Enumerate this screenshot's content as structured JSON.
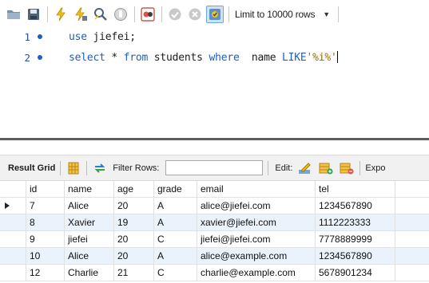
{
  "toolbar": {
    "buttons": [
      {
        "icon": "open-folder-icon"
      },
      {
        "icon": "save-icon"
      },
      {
        "icon": "execute-lightning-icon"
      },
      {
        "icon": "execute-current-lightning-icon"
      },
      {
        "icon": "explain-magnifier-icon"
      },
      {
        "icon": "stop-icon"
      },
      {
        "icon": "toggle-continue-on-error-icon"
      },
      {
        "icon": "commit-check-icon"
      },
      {
        "icon": "rollback-cancel-icon"
      },
      {
        "icon": "autocommit-toggle-icon"
      }
    ],
    "limit_label": "Limit to 10000 rows"
  },
  "editor": {
    "lines": [
      {
        "number": "1",
        "keyword1": "use",
        "rest": " jiefei;"
      },
      {
        "number": "2",
        "kw_select": "select",
        "star": " * ",
        "kw_from": "from",
        "table": " students ",
        "kw_where": "where",
        "col": "  name ",
        "kw_like": "LIKE",
        "pattern": "'%i%'"
      }
    ]
  },
  "result_toolbar": {
    "tab_label": "Result Grid",
    "filter_label": "Filter Rows:",
    "filter_value": "",
    "edit_label": "Edit:",
    "export_label": "Expo"
  },
  "grid": {
    "columns": [
      "id",
      "name",
      "age",
      "grade",
      "email",
      "tel"
    ],
    "rows": [
      {
        "id": "7",
        "name": "Alice",
        "age": "20",
        "grade": "A",
        "email": "alice@jiefei.com",
        "tel": "1234567890",
        "current": true
      },
      {
        "id": "8",
        "name": "Xavier",
        "age": "19",
        "grade": "A",
        "email": "xavier@jiefei.com",
        "tel": "1112223333",
        "current": false
      },
      {
        "id": "9",
        "name": "jiefei",
        "age": "20",
        "grade": "C",
        "email": "jiefei@jiefei.com",
        "tel": "7778889999",
        "current": false
      },
      {
        "id": "10",
        "name": "Alice",
        "age": "20",
        "grade": "A",
        "email": "alice@example.com",
        "tel": "1234567890",
        "current": false
      },
      {
        "id": "12",
        "name": "Charlie",
        "age": "21",
        "grade": "C",
        "email": "charlie@example.com",
        "tel": "5678901234",
        "current": false
      }
    ]
  },
  "colors": {
    "keyword": "#1a5fc8",
    "string": "#9b6a00",
    "line_number": "#2a50a4",
    "row_alt": "#eaf2fb"
  }
}
